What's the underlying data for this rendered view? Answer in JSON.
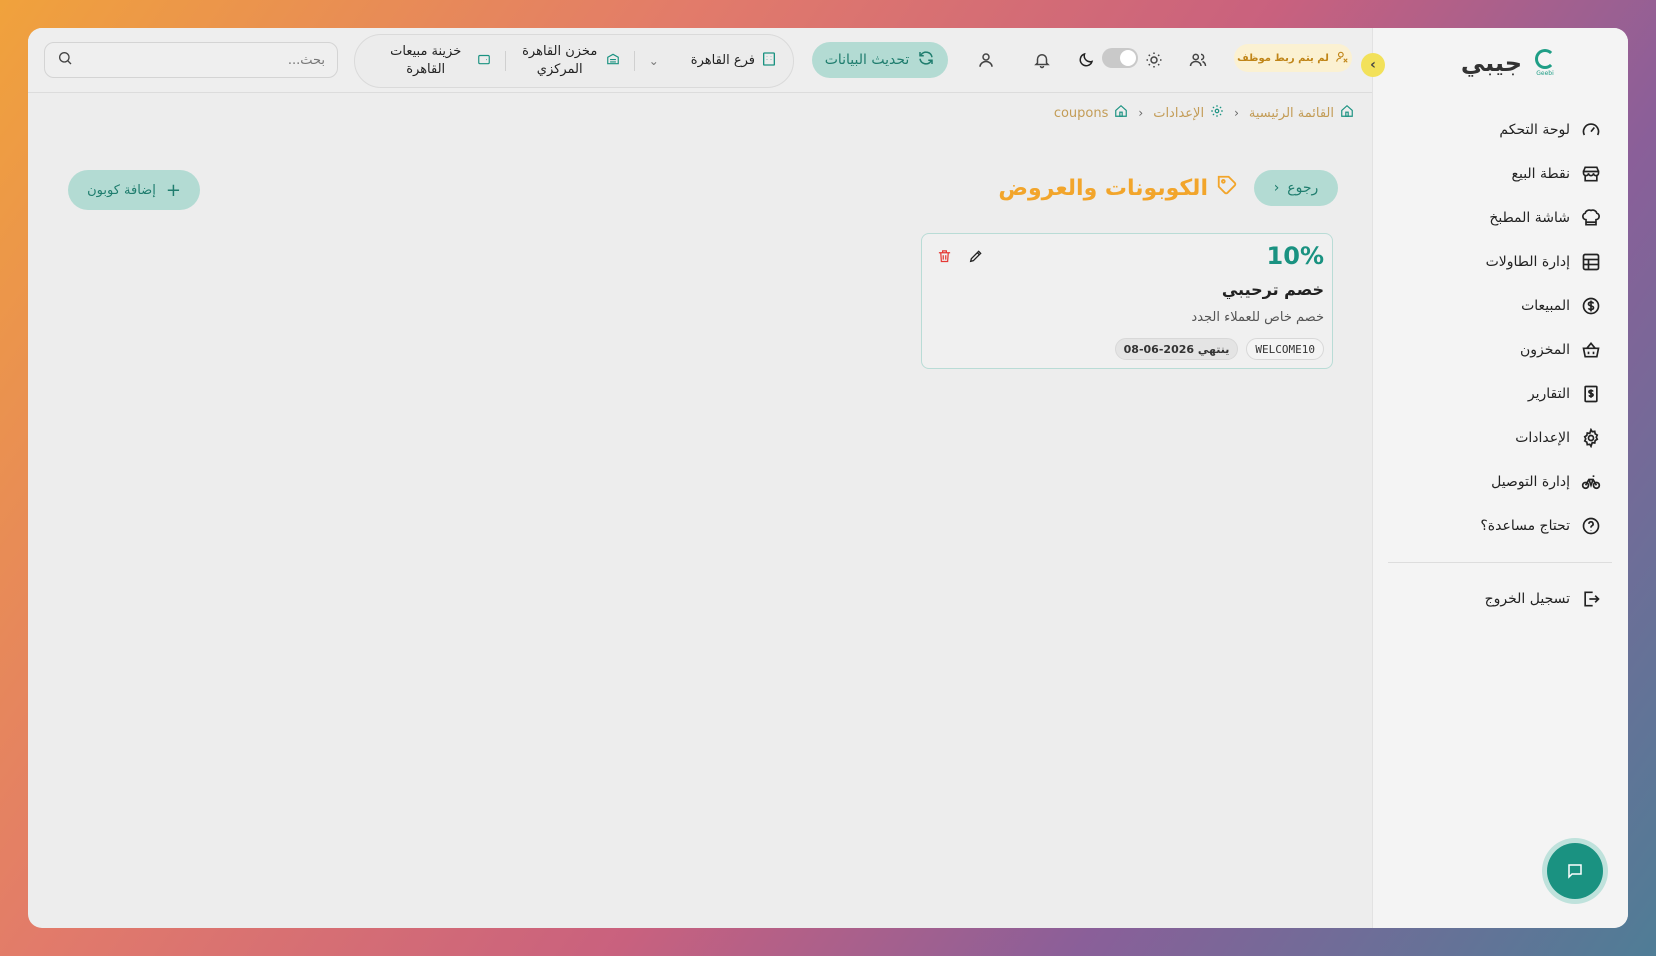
{
  "brand": {
    "name": "جيبي",
    "logo_text": "Geebi"
  },
  "sidebar": {
    "items": [
      {
        "label": "لوحة التحكم",
        "icon": "gauge-icon"
      },
      {
        "label": "نقطة البيع",
        "icon": "store-icon"
      },
      {
        "label": "شاشة المطبخ",
        "icon": "chef-hat-icon"
      },
      {
        "label": "إدارة الطاولات",
        "icon": "table-icon"
      },
      {
        "label": "المبيعات",
        "icon": "dollar-circle-icon"
      },
      {
        "label": "المخزون",
        "icon": "basket-icon"
      },
      {
        "label": "التقارير",
        "icon": "receipt-icon"
      },
      {
        "label": "الإعدادات",
        "icon": "gear-icon"
      },
      {
        "label": "إدارة التوصيل",
        "icon": "bicycle-icon"
      },
      {
        "label": "تحتاج مساعدة؟",
        "icon": "help-circle-icon"
      }
    ],
    "logout": "تسجيل الخروج"
  },
  "topbar": {
    "search_placeholder": "بحث...",
    "branch": "فرع القاهرة",
    "warehouse": "مخزن القاهرة المركزي",
    "cashbox": "خزينة مبيعات القاهرة",
    "refresh_label": "تحديث البيانات",
    "employee_badge": "لم يتم ربط موظف"
  },
  "breadcrumb": {
    "home": "القائمة الرئيسية",
    "settings": "الإعدادات",
    "current": "coupons"
  },
  "page": {
    "title": "الكوبونات والعروض",
    "back_label": "رجوع",
    "add_label": "إضافة كوبون"
  },
  "coupons": [
    {
      "discount": "10%",
      "name": "خصم ترحيبي",
      "description": "خصم خاص للعملاء الجدد",
      "code": "WELCOME10",
      "expiry": "ينتهي 2026-06-08"
    }
  ],
  "colors": {
    "primary": "#1a9281",
    "accent": "#f2a52b",
    "button_bg": "#b3dbd3",
    "danger": "#e53935"
  }
}
